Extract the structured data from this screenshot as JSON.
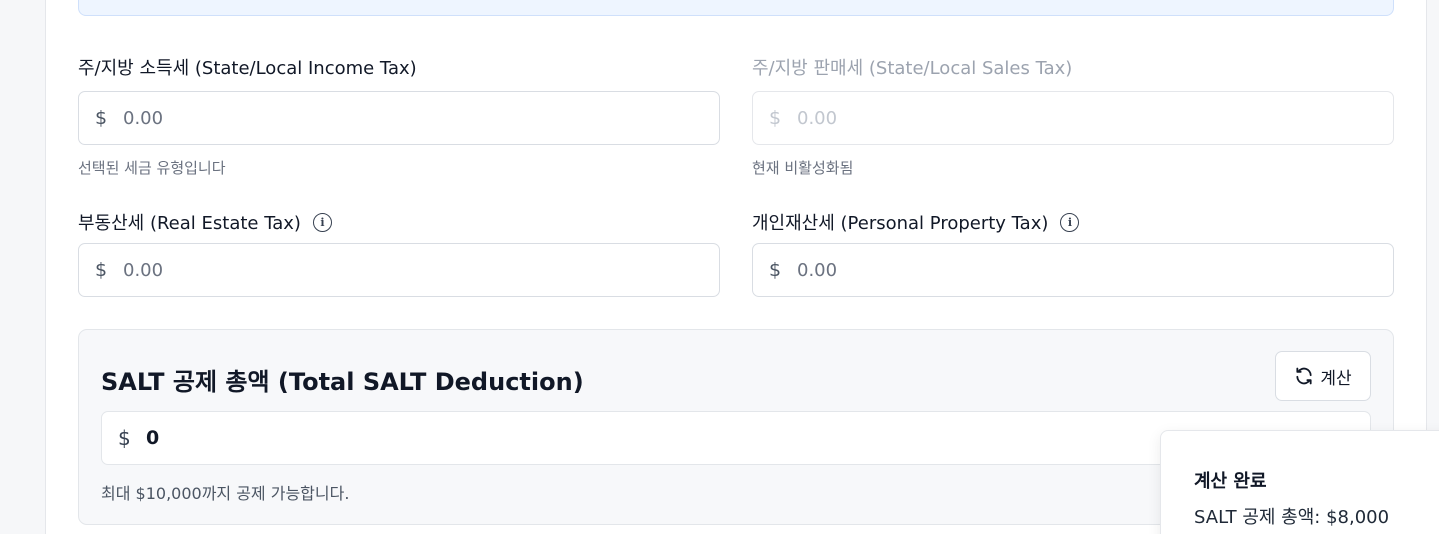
{
  "fields": {
    "income": {
      "label": "주/지방 소득세 (State/Local Income Tax)",
      "currency": "$",
      "placeholder": "0.00",
      "hint": "선택된 세금 유형입니다"
    },
    "sales": {
      "label": "주/지방 판매세 (State/Local Sales Tax)",
      "currency": "$",
      "placeholder": "0.00",
      "hint": "현재 비활성화됨"
    },
    "real_estate": {
      "label": "부동산세 (Real Estate Tax)",
      "currency": "$",
      "placeholder": "0.00"
    },
    "personal_property": {
      "label": "개인재산세 (Personal Property Tax)",
      "currency": "$",
      "placeholder": "0.00"
    }
  },
  "total": {
    "title": "SALT 공제 총액 (Total SALT Deduction)",
    "calc_button": "계산",
    "currency": "$",
    "value": "0",
    "hint": "최대 $10,000까지 공제 가능합니다."
  },
  "toast": {
    "title": "계산 완료",
    "body": "SALT 공제 총액: $8,000"
  },
  "icons": {
    "info": "info-circle-icon",
    "refresh": "refresh-icon"
  }
}
